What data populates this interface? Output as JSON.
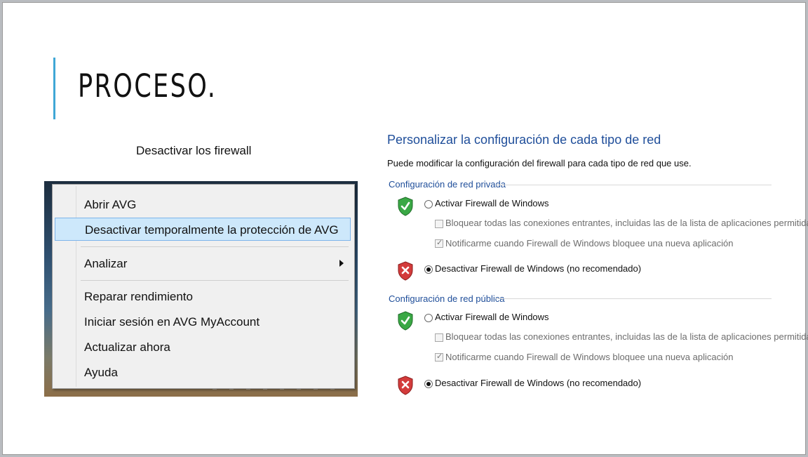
{
  "slide": {
    "title": "PROCESO.",
    "subtitle": "Desactivar los firewall",
    "accent_color": "#3fa7d6"
  },
  "avg_menu": {
    "items": [
      {
        "label": "Abrir AVG"
      },
      {
        "label": "Desactivar temporalmente la protección de AVG",
        "highlighted": true
      },
      {
        "label": "Analizar",
        "submenu": true
      },
      {
        "label": "Reparar rendimiento"
      },
      {
        "label": "Iniciar sesión en AVG MyAccount"
      },
      {
        "label": "Actualizar ahora"
      },
      {
        "label": "Ayuda"
      }
    ],
    "highlight_color": "#cde8fb"
  },
  "firewall": {
    "title": "Personalizar la configuración de cada tipo de red",
    "description": "Puede modificar la configuración del firewall para cada tipo de red que use.",
    "title_color": "#1f4e9a",
    "private": {
      "heading": "Configuración de red privada",
      "activate_label": "Activar Firewall de Windows",
      "block_label": "Bloquear todas las conexiones entrantes, incluidas las de la lista de aplicaciones permitidas",
      "notify_label": "Notificarme cuando Firewall de Windows bloquee una nueva aplicación",
      "deactivate_label": "Desactivar Firewall de Windows (no recomendado)",
      "selected": "deactivate"
    },
    "public": {
      "heading": "Configuración de red pública",
      "activate_label": "Activar Firewall de Windows",
      "block_label": "Bloquear todas las conexiones entrantes, incluidas las de la lista de aplicaciones permitidas",
      "notify_label": "Notificarme cuando Firewall de Windows bloquee una nueva aplicación",
      "deactivate_label": "Desactivar Firewall de Windows (no recomendado)",
      "selected": "deactivate"
    }
  }
}
